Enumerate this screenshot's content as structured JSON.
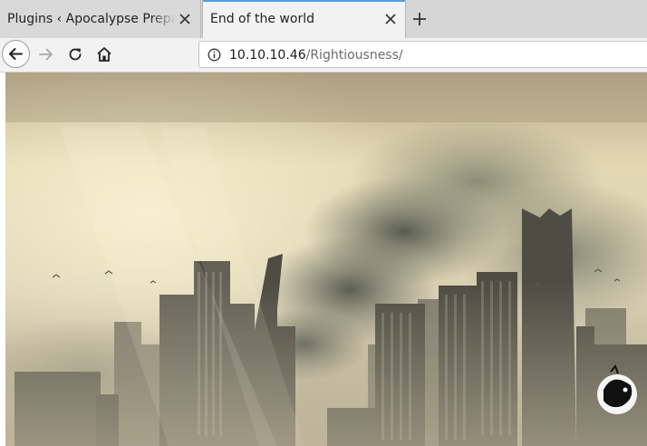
{
  "tabs": [
    {
      "title": "Plugins ‹ Apocalypse Prepara",
      "active": false
    },
    {
      "title": "End of the world",
      "active": true
    }
  ],
  "address_bar": {
    "host": "10.10.10.46",
    "path": "/Rightiousness/"
  },
  "icons": {
    "tab_close": "close-icon",
    "new_tab": "plus-icon",
    "back": "arrow-left-icon",
    "forward": "arrow-right-icon",
    "reload": "reload-icon",
    "home": "home-icon",
    "site_info": "info-icon",
    "watermark": "crow-logo-icon"
  },
  "colors": {
    "accent": "#5c9cd6",
    "tabbar_bg": "#d6d6d6",
    "toolbar_bg": "#f2f2f2"
  }
}
